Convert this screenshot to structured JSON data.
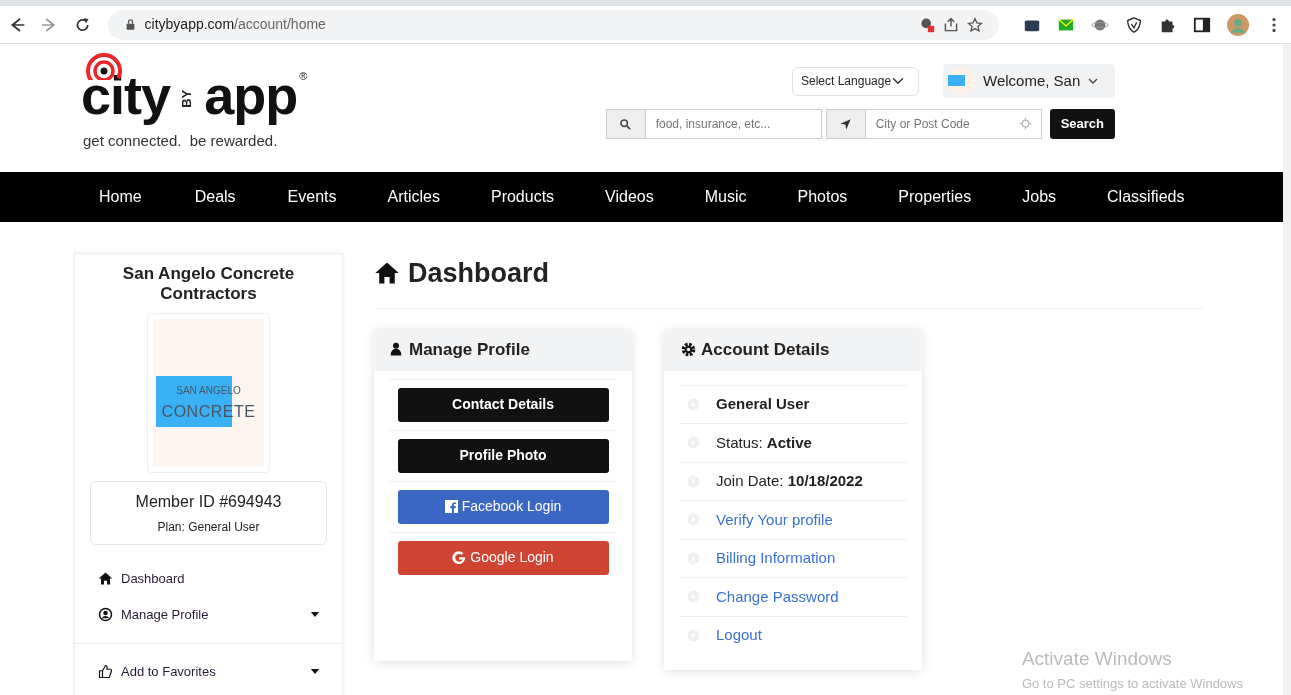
{
  "browser": {
    "url_host": "citybyapp.com",
    "url_path": "/account/home"
  },
  "logo": {
    "word_1": "city",
    "word_2": "BY",
    "word_3": "app",
    "mark": "®",
    "tagline": "get connected.  be rewarded."
  },
  "language_select": {
    "value": "Select Language"
  },
  "user_menu": {
    "label": "Welcome, San"
  },
  "search": {
    "placeholder": "food, insurance, etc...",
    "location_placeholder": "City or Post Code",
    "button": "Search"
  },
  "nav": [
    "Home",
    "Deals",
    "Events",
    "Articles",
    "Products",
    "Videos",
    "Music",
    "Photos",
    "Properties",
    "Jobs",
    "Classifieds"
  ],
  "sidebar": {
    "company": "San Angelo Concrete Contractors",
    "logo_lines": [
      "SAN ANGELO",
      "CONCRETE"
    ],
    "member_id": "Member ID #694943",
    "plan": "Plan: General User",
    "menu": [
      {
        "label": "Dashboard",
        "expandable": false
      },
      {
        "label": "Manage Profile",
        "expandable": true
      },
      {
        "label": "Add to Favorites",
        "expandable": true
      }
    ]
  },
  "page_title": "Dashboard",
  "manage_profile": {
    "title": "Manage Profile",
    "buttons": [
      {
        "label": "Contact Details",
        "kind": "dark"
      },
      {
        "label": "Profile Photo",
        "kind": "dark"
      },
      {
        "label": "Facebook Login",
        "kind": "facebook"
      },
      {
        "label": "Google Login",
        "kind": "google"
      }
    ]
  },
  "account_details": {
    "title": "Account Details",
    "items": [
      {
        "kind": "strong",
        "label": "General User"
      },
      {
        "kind": "field",
        "label": "Status: **Active**"
      },
      {
        "kind": "field",
        "label": "Join Date: **10/18/2022**"
      },
      {
        "kind": "link",
        "label": "Verify Your profile"
      },
      {
        "kind": "link",
        "label": "Billing Information"
      },
      {
        "kind": "link",
        "label": "Change Password"
      },
      {
        "kind": "link",
        "label": "Logout"
      }
    ]
  },
  "os_notice": [
    "Activate Windows",
    "Go to PC settings to activate Windows"
  ]
}
